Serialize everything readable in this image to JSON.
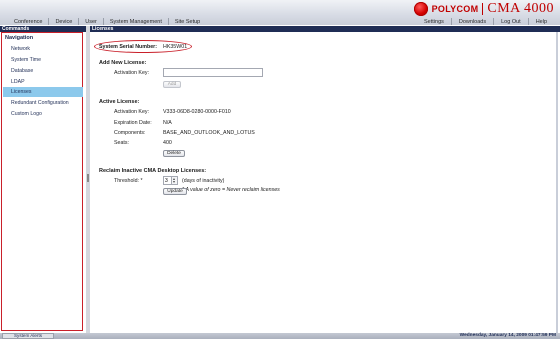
{
  "brand": {
    "company": "POLYCOM",
    "product": "CMA 4000"
  },
  "menu": {
    "items": [
      "Conference",
      "Device",
      "User",
      "System Management",
      "Site Setup"
    ],
    "right_items": [
      "Settings",
      "Downloads",
      "Log Out",
      "Help"
    ]
  },
  "sidebar": {
    "title": "Commands",
    "nav_header": "Navigation",
    "items": [
      {
        "label": "Network",
        "active": false
      },
      {
        "label": "System Time",
        "active": false
      },
      {
        "label": "Database",
        "active": false
      },
      {
        "label": "LDAP",
        "active": false
      },
      {
        "label": "Licenses",
        "active": true
      },
      {
        "label": "Redundant Configuration",
        "active": false
      },
      {
        "label": "Custom Logo",
        "active": false
      }
    ]
  },
  "main": {
    "title": "Licenses",
    "serial_label": "System Serial Number:",
    "serial_value": "HK35W01",
    "add_license": {
      "header": "Add New License:",
      "activation_key_label": "Activation Key:",
      "activation_key_value": "",
      "add_button": "Add"
    },
    "active_license": {
      "header": "Active License:",
      "activation_key_label": "Activation Key:",
      "activation_key_value": "V333-06D8-0280-0000-F010",
      "expiration_label": "Expiration Date:",
      "expiration_value": "N/A",
      "components_label": "Components:",
      "components_value": "BASE_AND_OUTLOOK_AND_LOTUS",
      "seats_label": "Seats:",
      "seats_value": "400",
      "delete_button": "Delete"
    },
    "reclaim": {
      "header": "Reclaim Inactive CMA Desktop Licenses:",
      "threshold_label": "Threshold: *",
      "threshold_value": "3",
      "threshold_unit": "(days of inactivity)",
      "note": "* A value of zero = Never reclaim licenses",
      "update_button": "Update"
    }
  },
  "status": {
    "alerts_tab": "System Alerts",
    "datetime": "Wednesday, January 14, 2009 01:47:59 PM"
  },
  "colors": {
    "accent_navy": "#1f2d55",
    "highlight_red": "#c9202a",
    "selected_nav": "#8cc9ec",
    "brand_red": "#c00000"
  }
}
